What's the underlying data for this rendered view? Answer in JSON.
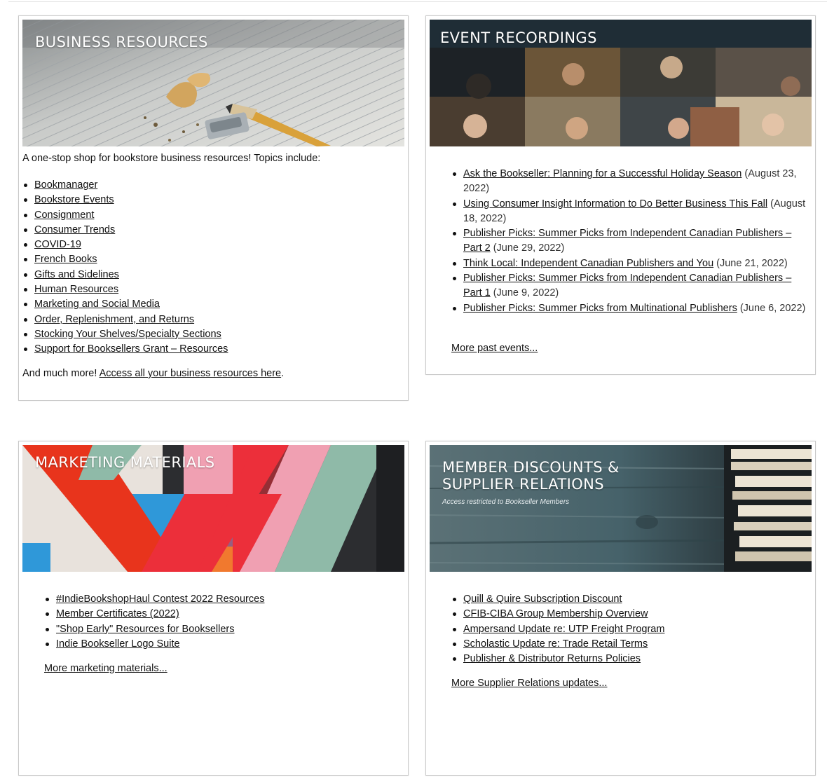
{
  "business": {
    "title": "BUSINESS RESOURCES",
    "intro": "A one-stop shop for bookstore business resources! Topics include:",
    "topics": [
      "Bookmanager",
      "Bookstore Events",
      "Consignment",
      "Consumer Trends",
      "COVID-19",
      "French Books",
      "Gifts and Sidelines",
      "Human Resources",
      "Marketing and Social Media",
      "Order, Replenishment, and Returns",
      "Stocking Your Shelves/Specialty Sections",
      "Support for Booksellers Grant – Resources"
    ],
    "outro_prefix": "And much more! ",
    "outro_link": "Access all your business resources here",
    "outro_suffix": "."
  },
  "events": {
    "title": "EVENT RECORDINGS",
    "items": [
      {
        "link": "Ask the Bookseller: Planning for a Successful Holiday Season",
        "date": " (August 23, 2022)"
      },
      {
        "link": "Using Consumer Insight Information to Do Better Business This Fall",
        "date": " (August 18, 2022)"
      },
      {
        "link": "Publisher Picks: Summer Picks from Independent Canadian Publishers – Part 2",
        "date": " (June 29, 2022)"
      },
      {
        "link": "Think Local: Independent Canadian Publishers and You",
        "date": " (June 21, 2022)"
      },
      {
        "link": "Publisher Picks: Summer Picks from Independent Canadian Publishers – Part 1",
        "date": " (June 9, 2022)"
      },
      {
        "link": "Publisher Picks: Summer Picks from Multinational Publishers",
        "date": " (June 6, 2022)"
      }
    ],
    "more": "More past events..."
  },
  "marketing": {
    "title": "MARKETING MATERIALS",
    "items": [
      "#IndieBookshopHaul Contest 2022 Resources ",
      "Member Certificates (2022)",
      "\"Shop Early\" Resources for Booksellers",
      "Indie Bookseller Logo Suite"
    ],
    "more": "More marketing materials..."
  },
  "members": {
    "title_line1": "MEMBER DISCOUNTS &",
    "title_line2": "SUPPLIER RELATIONS",
    "subtitle": "Access restricted to Bookseller Members",
    "items": [
      "Quill & Quire Subscription Discount",
      "CFIB-CIBA Group Membership Overview",
      "Ampersand Update re: UTP Freight Program",
      "Scholastic Update re: Trade Retail Terms",
      "Publisher & Distributor Returns Policies"
    ],
    "more": "More Supplier Relations updates..."
  }
}
